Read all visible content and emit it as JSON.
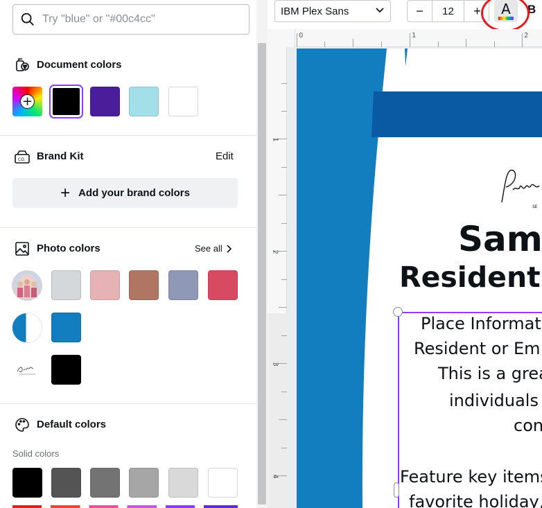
{
  "search": {
    "placeholder": "Try \"blue\" or \"#00c4cc\""
  },
  "document_colors": {
    "title": "Document colors",
    "swatches": [
      "#000000",
      "#4a1e9a",
      "#a3dfe9",
      "#ffffff"
    ],
    "selected": "#000000"
  },
  "brand_kit": {
    "title": "Brand Kit",
    "edit_label": "Edit",
    "add_label": "Add your brand colors"
  },
  "photo_colors": {
    "title": "Photo colors",
    "see_all_label": "See all",
    "rows": [
      [
        "#d4d8db",
        "#e6b3b4",
        "#b07563",
        "#8f99b5",
        "#d84a62"
      ],
      [
        "#137ebf"
      ],
      [
        "#000000"
      ]
    ]
  },
  "default_colors": {
    "title": "Default colors",
    "solid_label": "Solid colors",
    "swatches": [
      "#000000",
      "#545454",
      "#737373",
      "#a6a6a6",
      "#d9d9d9",
      "#ffffff"
    ]
  },
  "toolbar": {
    "font_name": "IBM Plex Sans",
    "font_size": "12",
    "minus_label": "−",
    "plus_label": "+",
    "text_color_letter": "A",
    "bold_label": "B",
    "highlight_color": "#e8191e"
  },
  "rulers": {
    "top_numbers": [
      "0",
      "1",
      "2"
    ],
    "left_numbers": [
      "1",
      "2",
      "3",
      "4"
    ]
  },
  "document": {
    "name": "Sam",
    "role": "Resident o",
    "body_lines": [
      "Place Informat",
      "Resident or Em",
      "This is a grea",
      "individuals",
      "con",
      "",
      "Feature key items",
      "favorite holiday,"
    ],
    "colors": {
      "blue_left": "#137ebf",
      "blue_band": "#0a5aa3"
    }
  }
}
